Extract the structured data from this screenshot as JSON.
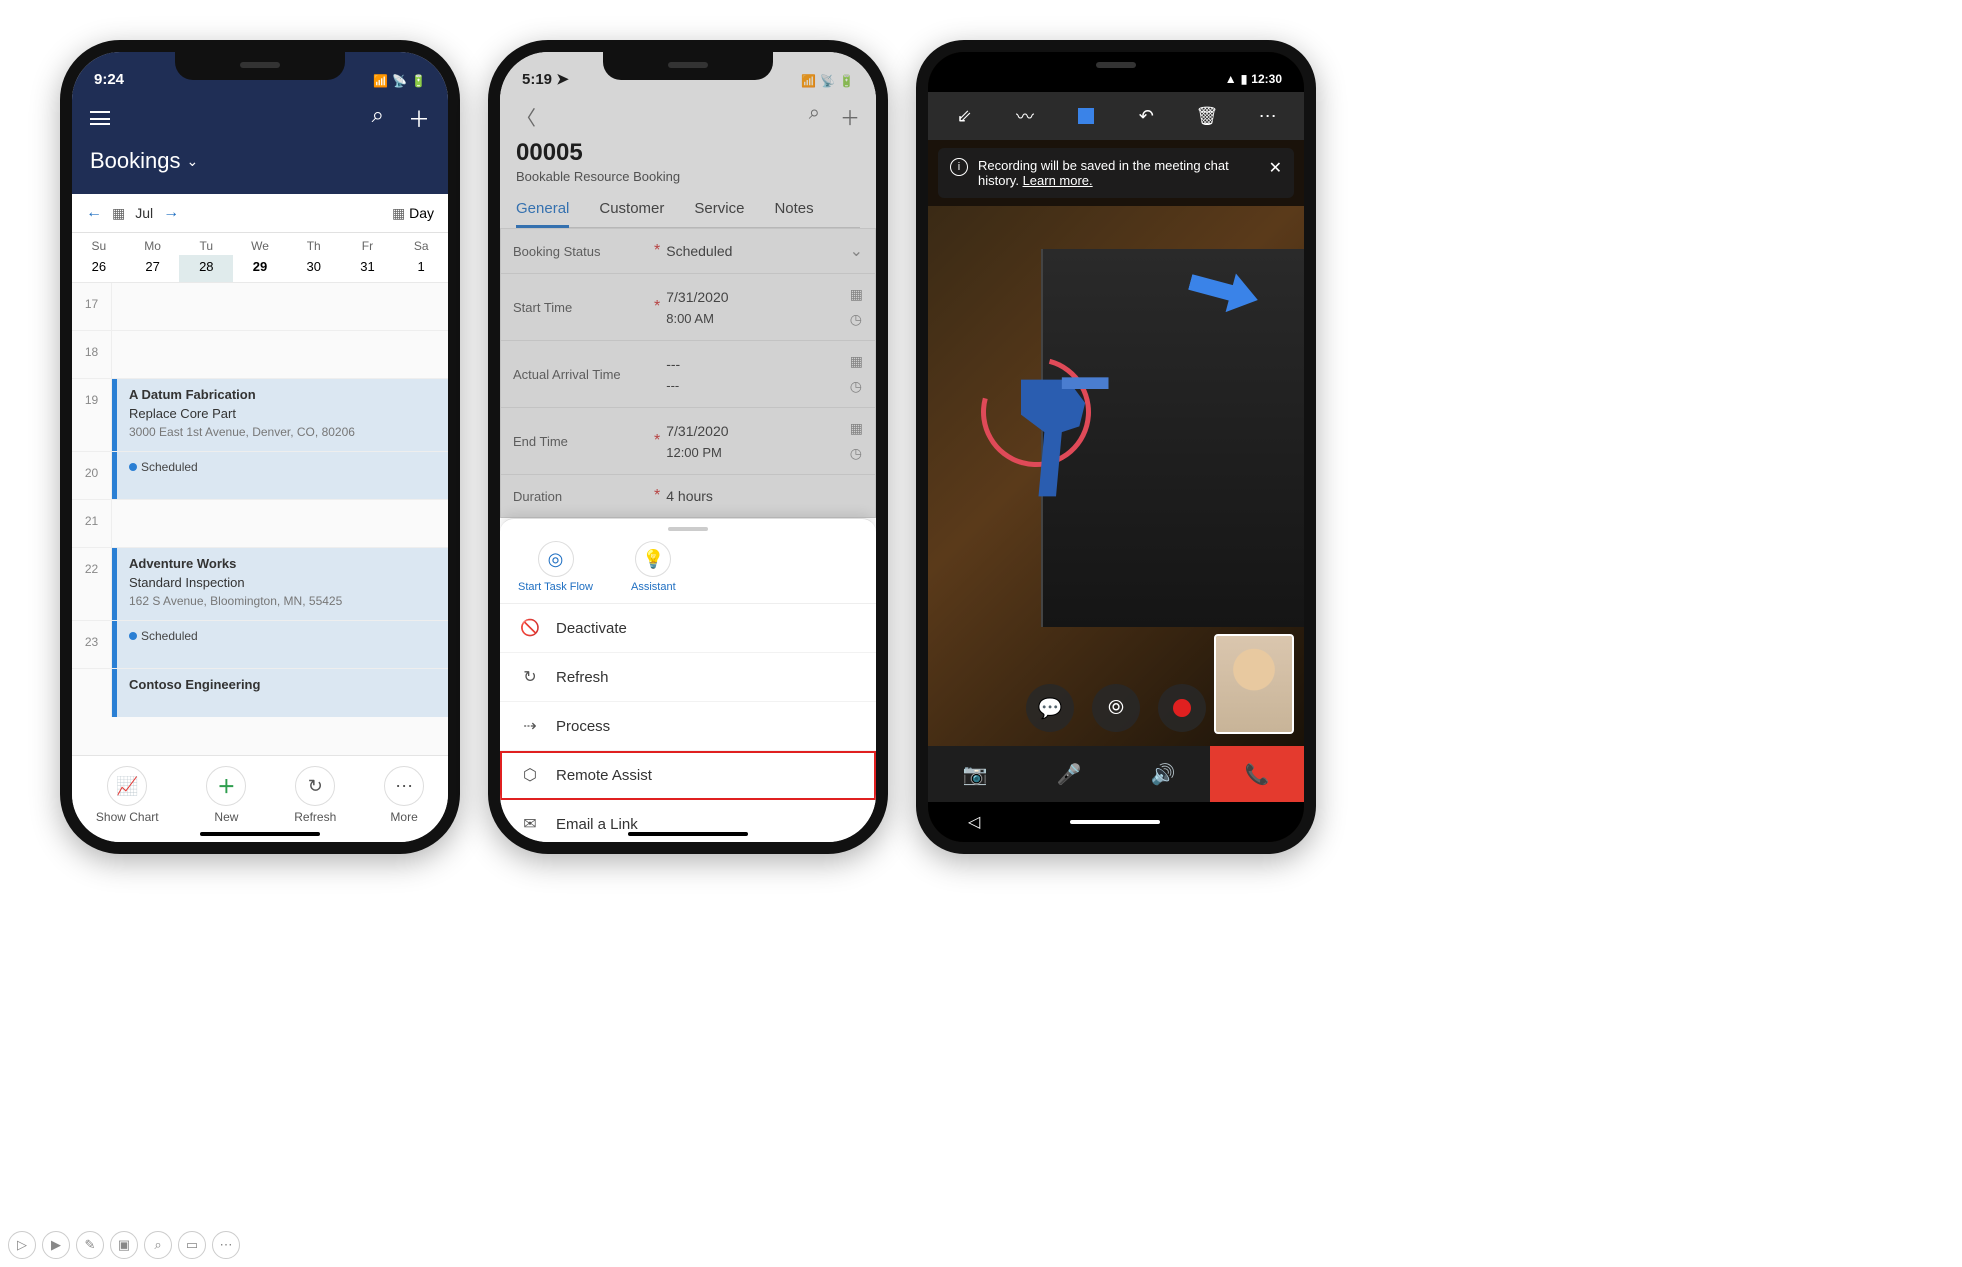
{
  "phone1": {
    "status_time": "9:24",
    "page_title": "Bookings",
    "month": "Jul",
    "view_label": "Day",
    "week_days": [
      "Su",
      "Mo",
      "Tu",
      "We",
      "Th",
      "Fr",
      "Sa"
    ],
    "week_dates": [
      "26",
      "27",
      "28",
      "29",
      "30",
      "31",
      "1"
    ],
    "selected_col": 2,
    "bold_col": 3,
    "hours": [
      "17",
      "18",
      "19",
      "20",
      "21",
      "22",
      "23"
    ],
    "event1": {
      "title": "A Datum Fabrication",
      "line2": "Replace Core Part",
      "line3": "3000 East 1st Avenue, Denver, CO, 80206",
      "status": "Scheduled"
    },
    "event2": {
      "title": "Adventure Works",
      "line2": "Standard Inspection",
      "line3": "162 S Avenue, Bloomington, MN, 55425",
      "status": "Scheduled"
    },
    "event3": {
      "title": "Contoso Engineering"
    },
    "actions": {
      "chart": "Show Chart",
      "new": "New",
      "refresh": "Refresh",
      "more": "More"
    }
  },
  "phone2": {
    "status_time": "5:19",
    "record_no": "00005",
    "subtitle": "Bookable Resource Booking",
    "tabs": [
      "General",
      "Customer",
      "Service",
      "Notes"
    ],
    "fields": {
      "booking_status": {
        "label": "Booking Status",
        "value": "Scheduled"
      },
      "start_time": {
        "label": "Start Time",
        "value1": "7/31/2020",
        "value2": "8:00 AM"
      },
      "arrival": {
        "label": "Actual Arrival Time",
        "value1": "---",
        "value2": "---"
      },
      "end_time": {
        "label": "End Time",
        "value1": "7/31/2020",
        "value2": "12:00 PM"
      },
      "duration": {
        "label": "Duration",
        "value": "4 hours"
      }
    },
    "sheet": {
      "start_task": "Start Task Flow",
      "assistant": "Assistant",
      "items": [
        "Deactivate",
        "Refresh",
        "Process",
        "Remote Assist",
        "Email a Link"
      ]
    }
  },
  "phone3": {
    "status_time": "12:30",
    "banner_text": "Recording will be saved in the meeting chat history.",
    "learn_more": "Learn more."
  }
}
